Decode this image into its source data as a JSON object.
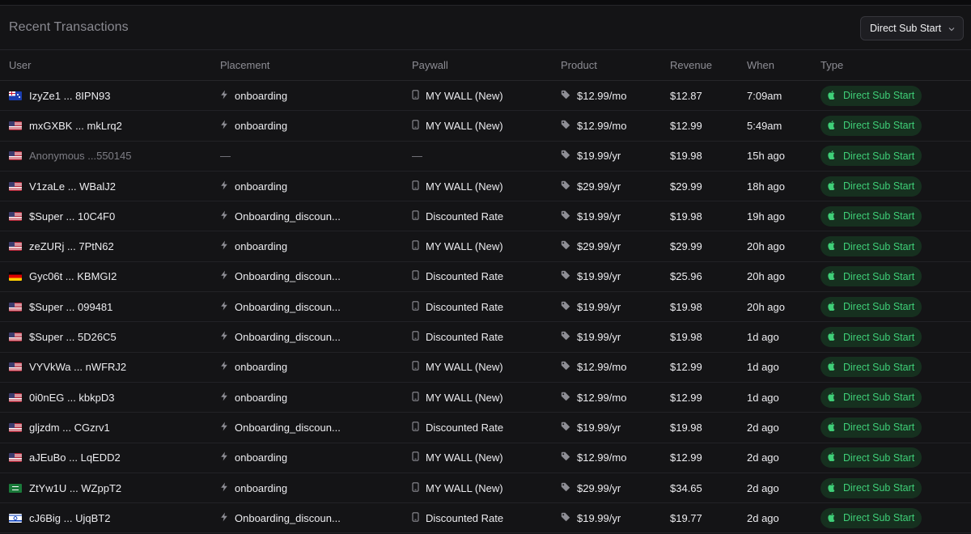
{
  "panel": {
    "title": "Recent Transactions",
    "filter": {
      "label": "Direct Sub Start",
      "icon": "chevron-down-icon"
    }
  },
  "columns": [
    "User",
    "Placement",
    "Paywall",
    "Product",
    "Revenue",
    "When",
    "Type"
  ],
  "icons": {
    "placement": "bolt-icon",
    "paywall": "phone-icon",
    "product": "tag-icon",
    "type": "apple-icon"
  },
  "colors": {
    "badge_bg": "#16301f",
    "badge_text": "#3fcf78",
    "panel_bg": "#141416"
  },
  "rows": [
    {
      "flag": "au",
      "user": "IzyZe1 ... 8IPN93",
      "placement": "onboarding",
      "paywall": "MY WALL (New)",
      "product": "$12.99/mo",
      "revenue": "$12.87",
      "when": "7:09am",
      "type": "Direct Sub Start"
    },
    {
      "flag": "us",
      "user": "mxGXBK ... mkLrq2",
      "placement": "onboarding",
      "paywall": "MY WALL (New)",
      "product": "$12.99/mo",
      "revenue": "$12.99",
      "when": "5:49am",
      "type": "Direct Sub Start"
    },
    {
      "flag": "us",
      "user": "Anonymous ...550145",
      "placement": "—",
      "paywall": "—",
      "product": "$19.99/yr",
      "revenue": "$19.98",
      "when": "15h ago",
      "type": "Direct Sub Start",
      "anonymous": true
    },
    {
      "flag": "us",
      "user": "V1zaLe ... WBalJ2",
      "placement": "onboarding",
      "paywall": "MY WALL (New)",
      "product": "$29.99/yr",
      "revenue": "$29.99",
      "when": "18h ago",
      "type": "Direct Sub Start"
    },
    {
      "flag": "us",
      "user": "$Super ... 10C4F0",
      "placement": "Onboarding_discoun...",
      "paywall": "Discounted Rate",
      "product": "$19.99/yr",
      "revenue": "$19.98",
      "when": "19h ago",
      "type": "Direct Sub Start"
    },
    {
      "flag": "us",
      "user": "zeZURj ... 7PtN62",
      "placement": "onboarding",
      "paywall": "MY WALL (New)",
      "product": "$29.99/yr",
      "revenue": "$29.99",
      "when": "20h ago",
      "type": "Direct Sub Start"
    },
    {
      "flag": "de",
      "user": "Gyc06t ... KBMGI2",
      "placement": "Onboarding_discoun...",
      "paywall": "Discounted Rate",
      "product": "$19.99/yr",
      "revenue": "$25.96",
      "when": "20h ago",
      "type": "Direct Sub Start"
    },
    {
      "flag": "us",
      "user": "$Super ... 099481",
      "placement": "Onboarding_discoun...",
      "paywall": "Discounted Rate",
      "product": "$19.99/yr",
      "revenue": "$19.98",
      "when": "20h ago",
      "type": "Direct Sub Start"
    },
    {
      "flag": "us",
      "user": "$Super ... 5D26C5",
      "placement": "Onboarding_discoun...",
      "paywall": "Discounted Rate",
      "product": "$19.99/yr",
      "revenue": "$19.98",
      "when": "1d ago",
      "type": "Direct Sub Start"
    },
    {
      "flag": "us",
      "user": "VYVkWa ... nWFRJ2",
      "placement": "onboarding",
      "paywall": "MY WALL (New)",
      "product": "$12.99/mo",
      "revenue": "$12.99",
      "when": "1d ago",
      "type": "Direct Sub Start"
    },
    {
      "flag": "us",
      "user": "0i0nEG ... kbkpD3",
      "placement": "onboarding",
      "paywall": "MY WALL (New)",
      "product": "$12.99/mo",
      "revenue": "$12.99",
      "when": "1d ago",
      "type": "Direct Sub Start"
    },
    {
      "flag": "us",
      "user": "gljzdm ... CGzrv1",
      "placement": "Onboarding_discoun...",
      "paywall": "Discounted Rate",
      "product": "$19.99/yr",
      "revenue": "$19.98",
      "when": "2d ago",
      "type": "Direct Sub Start"
    },
    {
      "flag": "us",
      "user": "aJEuBo ... LqEDD2",
      "placement": "onboarding",
      "paywall": "MY WALL (New)",
      "product": "$12.99/mo",
      "revenue": "$12.99",
      "when": "2d ago",
      "type": "Direct Sub Start"
    },
    {
      "flag": "sa",
      "user": "ZtYw1U ... WZppT2",
      "placement": "onboarding",
      "paywall": "MY WALL (New)",
      "product": "$29.99/yr",
      "revenue": "$34.65",
      "when": "2d ago",
      "type": "Direct Sub Start"
    },
    {
      "flag": "il",
      "user": "cJ6Big ... UjqBT2",
      "placement": "Onboarding_discoun...",
      "paywall": "Discounted Rate",
      "product": "$19.99/yr",
      "revenue": "$19.77",
      "when": "2d ago",
      "type": "Direct Sub Start"
    }
  ]
}
